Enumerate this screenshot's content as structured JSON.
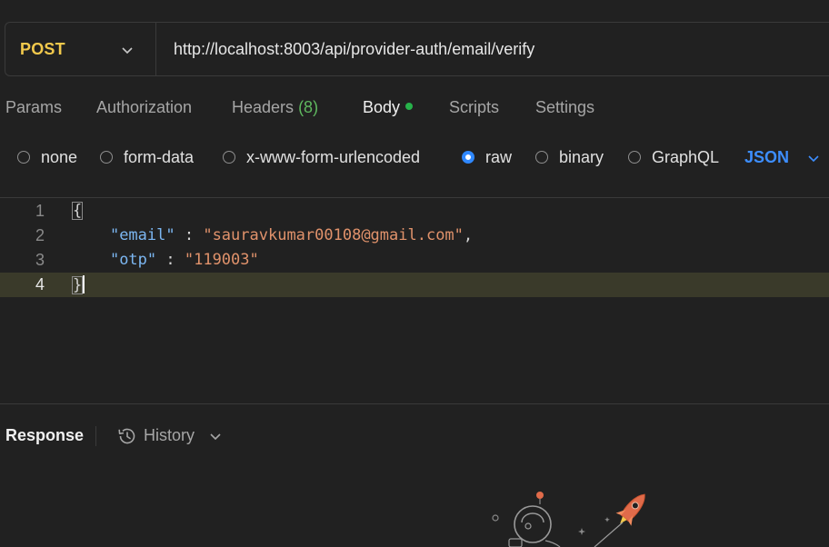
{
  "request": {
    "method": "POST",
    "url": "http://localhost:8003/api/provider-auth/email/verify"
  },
  "tabs": {
    "params": "Params",
    "authorization": "Authorization",
    "headers": "Headers",
    "headers_count": "(8)",
    "body": "Body",
    "scripts": "Scripts",
    "settings": "Settings",
    "active": "Body"
  },
  "body_types": {
    "none": "none",
    "form_data": "form-data",
    "urlencoded": "x-www-form-urlencoded",
    "raw": "raw",
    "binary": "binary",
    "graphql": "GraphQL",
    "selected": "raw",
    "language": "JSON"
  },
  "editor": {
    "lines": [
      {
        "no": "1",
        "open_brace": "{"
      },
      {
        "no": "2",
        "key": "\"email\"",
        "sep": " : ",
        "value": "\"sauravkumar00108@gmail.com\"",
        "trail": ","
      },
      {
        "no": "3",
        "key": "\"otp\"",
        "sep": " : ",
        "value": "\"119003\"",
        "trail": ""
      },
      {
        "no": "4",
        "close_brace": "}"
      }
    ],
    "current_line": "4"
  },
  "response": {
    "title": "Response",
    "history_label": "History"
  },
  "colors": {
    "method": "#f2c94c",
    "accent": "#2f88ff",
    "json_key": "#7cb7f2",
    "json_string": "#e0926b",
    "active_dot": "#27b24a",
    "headers_count": "#5fb85f"
  },
  "icons": {
    "method_dropdown": "chevron-down-icon",
    "language_dropdown": "chevron-down-icon",
    "history": "history-clock-icon",
    "history_dropdown": "chevron-down-icon",
    "empty_state": "astronaut-rocket-illustration"
  }
}
